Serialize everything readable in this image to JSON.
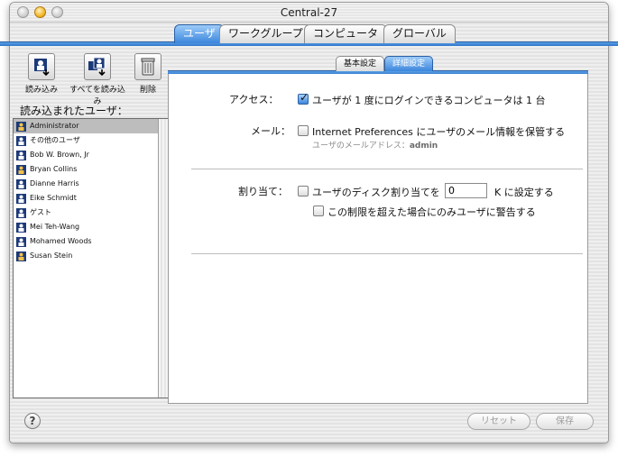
{
  "window": {
    "title": "Central-27"
  },
  "main_tabs": [
    {
      "label": "ユーザ",
      "active": true
    },
    {
      "label": "ワークグループ",
      "active": false
    },
    {
      "label": "コンピュータ",
      "active": false
    },
    {
      "label": "グローバル",
      "active": false
    }
  ],
  "toolbar": {
    "load_label": "読み込み",
    "load_all_label": "すべてを読み込み",
    "delete_label": "削除"
  },
  "sidebar": {
    "loaded_users_label": "読み込まれたユーザ：",
    "users": [
      {
        "name": "Administrator",
        "icon": "admin-user-icon",
        "selected": true
      },
      {
        "name": "その他のユーザ",
        "icon": "user-icon",
        "selected": false
      },
      {
        "name": "Bob W. Brown, Jr",
        "icon": "user-icon",
        "selected": false
      },
      {
        "name": "Bryan Collins",
        "icon": "admin-user-icon",
        "selected": false
      },
      {
        "name": "Dianne Harris",
        "icon": "user-icon",
        "selected": false
      },
      {
        "name": "Eike Schmidt",
        "icon": "user-icon",
        "selected": false
      },
      {
        "name": "ゲスト",
        "icon": "user-icon",
        "selected": false
      },
      {
        "name": "Mei Teh-Wang",
        "icon": "user-icon",
        "selected": false
      },
      {
        "name": "Mohamed Woods",
        "icon": "user-icon",
        "selected": false
      },
      {
        "name": "Susan Stein",
        "icon": "admin-user-icon",
        "selected": false
      }
    ]
  },
  "sub_tabs": [
    {
      "label": "基本設定",
      "active": false
    },
    {
      "label": "詳細設定",
      "active": true
    }
  ],
  "settings": {
    "access_label": "アクセス：",
    "access_option": "ユーザが 1 度にログインできるコンピュータは 1 台",
    "access_checked": true,
    "mail_label": "メール：",
    "mail_option": "Internet Preferences にユーザのメール情報を保管する",
    "mail_checked": false,
    "mail_address_label": "ユーザのメールアドレス：",
    "mail_address_value": "admin",
    "quota_label": "割り当て：",
    "quota_option": "ユーザのディスク割り当てを",
    "quota_checked": false,
    "quota_value": "0",
    "quota_unit": "K に設定する",
    "quota_warn_option": "この制限を超えた場合にのみユーザに警告する",
    "quota_warn_checked": false
  },
  "footer": {
    "help_label": "?",
    "revert_label": "リセット",
    "save_label": "保存"
  },
  "colors": {
    "accent": "#3c86dc",
    "selection": "#bdbdbd",
    "disabled_text": "#9a9a9a"
  }
}
